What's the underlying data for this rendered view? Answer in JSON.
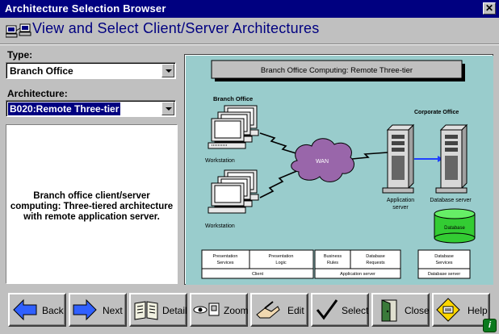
{
  "window": {
    "title": "Architecture Selection Browser",
    "close_glyph": "✕"
  },
  "header": {
    "title": "View and Select Client/Server Architectures",
    "icon": "network-computers-icon"
  },
  "form": {
    "type_label": "Type:",
    "type_value": "Branch Office",
    "architecture_label": "Architecture:",
    "architecture_value": "B020:Remote Three-tier"
  },
  "description": "Branch office client/server computing: Three-tiered architecture with remote application server.",
  "diagram": {
    "title": "Branch Office Computing: Remote Three-tier",
    "branch_office_label": "Branch Office",
    "corporate_office_label": "Corporate Office",
    "workstation_label_1": "Workstation",
    "workstation_label_2": "Workstation",
    "wan_label": "WAN",
    "app_server_label_1": "Application",
    "app_server_label_2": "server",
    "db_server_label": "Database server",
    "database_label": "Database",
    "client_box": {
      "cell1a": "Presentation",
      "cell1b": "Services",
      "cell2a": "Presentation",
      "cell2b": "Logic",
      "footer": "Client"
    },
    "app_box": {
      "cell1a": "Business",
      "cell1b": "Rules",
      "cell2a": "Database",
      "cell2b": "Requests",
      "footer": "Application server"
    },
    "db_box": {
      "cell1a": "Database",
      "cell1b": "Services",
      "footer": "Database server"
    },
    "background_color": "#99cccc"
  },
  "buttons": {
    "back": "Back",
    "next": "Next",
    "detail": "Detail",
    "zoom": "Zoom",
    "edit": "Edit",
    "select": "Select",
    "close": "Close",
    "help": "Help"
  },
  "colors": {
    "title_bar": "#000080",
    "header_text": "#000080",
    "face": "#c0c0c0",
    "wan_cloud": "#9966aa",
    "database": "#33cc33",
    "arrow_blue": "#2040ff"
  }
}
